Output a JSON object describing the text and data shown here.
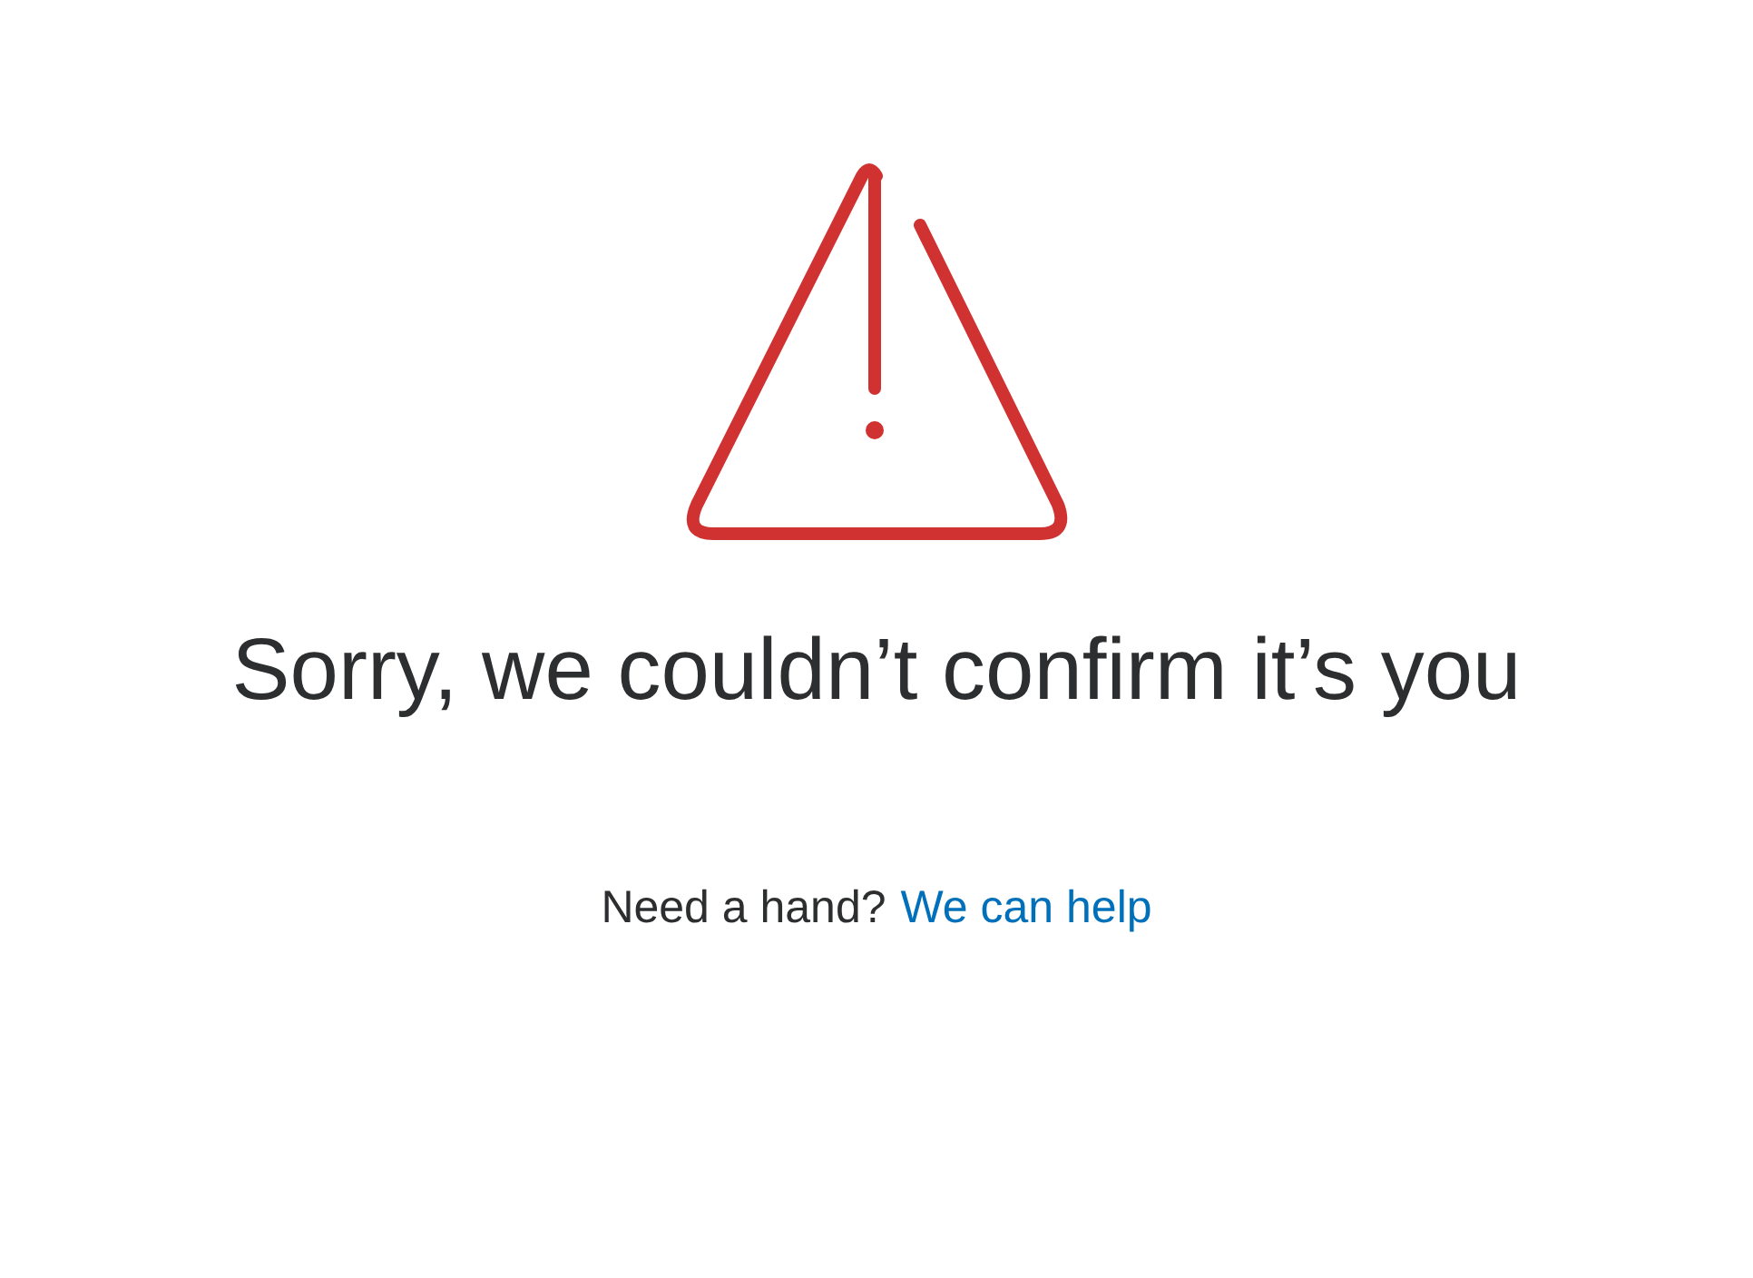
{
  "heading": "Sorry, we couldn’t confirm it’s you",
  "help": {
    "text": "Need a hand?",
    "link": "We can help"
  }
}
